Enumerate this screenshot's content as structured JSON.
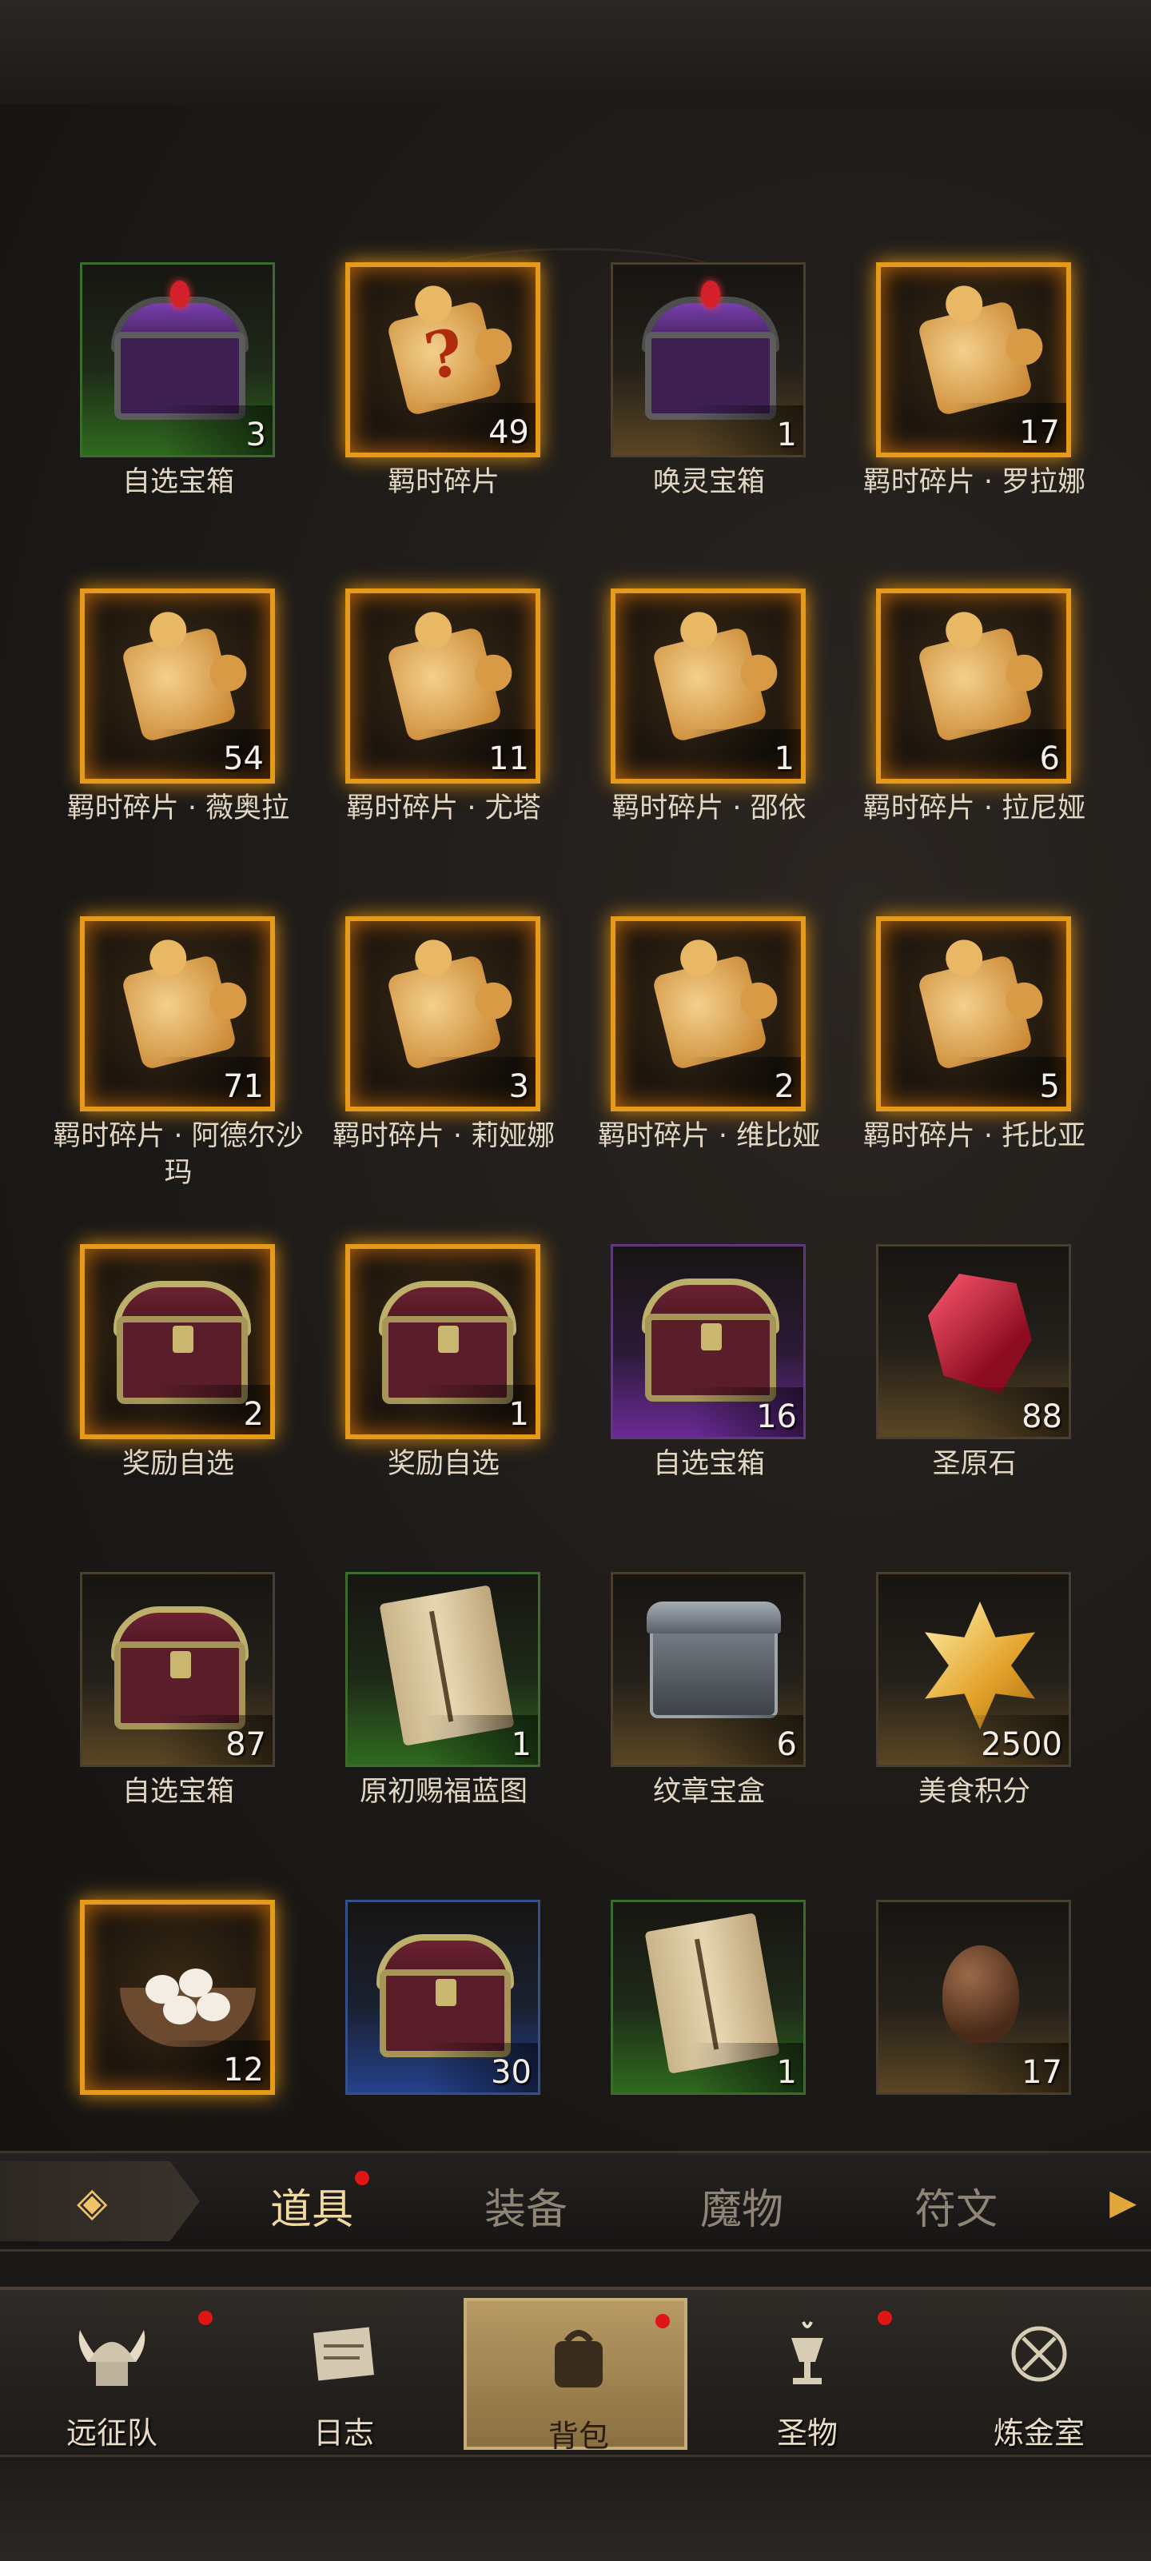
{
  "items": [
    {
      "label": "自选宝箱",
      "count": "3",
      "bg": "green",
      "icon": "purple-chest-icon"
    },
    {
      "label": "羁时碎片",
      "count": "49",
      "bg": "gold",
      "icon": "mystery-puzzle-icon"
    },
    {
      "label": "唤灵宝箱",
      "count": "1",
      "bg": "dark",
      "icon": "purple-chest-icon"
    },
    {
      "label": "羁时碎片 · 罗拉娜",
      "count": "17",
      "bg": "gold",
      "icon": "puzzle-piece-icon"
    },
    {
      "label": "羁时碎片 · 薇奥拉",
      "count": "54",
      "bg": "gold",
      "icon": "puzzle-piece-icon"
    },
    {
      "label": "羁时碎片 · 尤塔",
      "count": "11",
      "bg": "gold",
      "icon": "puzzle-piece-icon"
    },
    {
      "label": "羁时碎片 · 邵依",
      "count": "1",
      "bg": "gold",
      "icon": "puzzle-piece-icon"
    },
    {
      "label": "羁时碎片 · 拉尼娅",
      "count": "6",
      "bg": "gold",
      "icon": "puzzle-piece-icon"
    },
    {
      "label": "羁时碎片 · 阿德尔沙玛",
      "count": "71",
      "bg": "gold",
      "icon": "puzzle-piece-icon"
    },
    {
      "label": "羁时碎片 · 莉娅娜",
      "count": "3",
      "bg": "gold",
      "icon": "puzzle-piece-icon"
    },
    {
      "label": "羁时碎片 · 维比娅",
      "count": "2",
      "bg": "gold",
      "icon": "puzzle-piece-icon"
    },
    {
      "label": "羁时碎片 · 托比亚",
      "count": "5",
      "bg": "gold",
      "icon": "puzzle-piece-icon"
    },
    {
      "label": "奖励自选",
      "count": "2",
      "bg": "gold",
      "icon": "treasure-chest-icon"
    },
    {
      "label": "奖励自选",
      "count": "1",
      "bg": "gold",
      "icon": "treasure-chest-icon"
    },
    {
      "label": "自选宝箱",
      "count": "16",
      "bg": "purple",
      "icon": "treasure-chest-icon"
    },
    {
      "label": "圣原石",
      "count": "88",
      "bg": "dark",
      "icon": "ruby-gem-icon"
    },
    {
      "label": "自选宝箱",
      "count": "87",
      "bg": "dark",
      "icon": "treasure-chest-icon"
    },
    {
      "label": "原初赐福蓝图",
      "count": "1",
      "bg": "green",
      "icon": "scroll-icon"
    },
    {
      "label": "纹章宝盒",
      "count": "6",
      "bg": "dark",
      "icon": "jewel-box-icon"
    },
    {
      "label": "美食积分",
      "count": "2500",
      "bg": "dark",
      "icon": "star-crystal-icon"
    },
    {
      "label": "",
      "count": "12",
      "bg": "gold",
      "icon": "dumpling-bowl-icon"
    },
    {
      "label": "",
      "count": "30",
      "bg": "blue",
      "icon": "treasure-chest-icon"
    },
    {
      "label": "",
      "count": "1",
      "bg": "green",
      "icon": "scroll-icon"
    },
    {
      "label": "",
      "count": "17",
      "bg": "dark",
      "icon": "dragon-egg-icon"
    }
  ],
  "tabs": [
    {
      "label": "道具",
      "active": true,
      "notify": true
    },
    {
      "label": "装备",
      "active": false,
      "notify": false
    },
    {
      "label": "魔物",
      "active": false,
      "notify": false
    },
    {
      "label": "符文",
      "active": false,
      "notify": false
    }
  ],
  "nav": [
    {
      "label": "远征队",
      "icon": "viking-helmet-icon",
      "notify": true
    },
    {
      "label": "日志",
      "icon": "journal-map-icon",
      "notify": false
    },
    {
      "label": "背包",
      "icon": "backpack-icon",
      "notify": true,
      "active": true
    },
    {
      "label": "圣物",
      "icon": "relic-chalice-icon",
      "notify": true
    },
    {
      "label": "炼金室",
      "icon": "alchemy-sigil-icon",
      "notify": false
    }
  ],
  "colors": {
    "accent": "#e59a1a",
    "notify": "#e01515",
    "active_nav": "#b79a64"
  }
}
